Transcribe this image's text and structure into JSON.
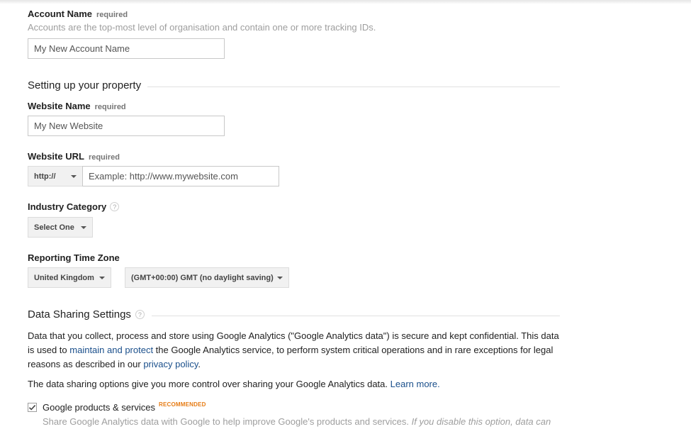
{
  "account": {
    "label": "Account Name",
    "required": "required",
    "help": "Accounts are the top-most level of organisation and contain one or more tracking IDs.",
    "placeholder": "My New Account Name"
  },
  "property": {
    "section_title": "Setting up your property",
    "website_name_label": "Website Name",
    "website_name_required": "required",
    "website_name_placeholder": "My New Website",
    "website_url_label": "Website URL",
    "website_url_required": "required",
    "protocol": "http://",
    "url_placeholder": "Example: http://www.mywebsite.com",
    "industry_label": "Industry Category",
    "industry_help": "?",
    "industry_value": "Select One",
    "timezone_label": "Reporting Time Zone",
    "country_value": "United Kingdom",
    "timezone_value": "(GMT+00:00) GMT (no daylight saving)"
  },
  "data_sharing": {
    "title": "Data Sharing Settings",
    "help": "?",
    "p1_a": "Data that you collect, process and store using Google Analytics (\"Google Analytics data\") is secure and kept confidential. This data is used to ",
    "p1_link1": "maintain and protect",
    "p1_b": " the Google Analytics service, to perform system critical operations and in rare exceptions for legal reasons as described in our ",
    "p1_link2": "privacy policy",
    "p1_c": ".",
    "p2_a": "The data sharing options give you more control over sharing your Google Analytics data. ",
    "p2_link": "Learn more.",
    "option1_label": "Google products & services",
    "option1_badge": "RECOMMENDED",
    "option1_checked": true,
    "option1_desc": "Share Google Analytics data with Google to help improve Google's products and services. ",
    "option1_desc_italic": "If you disable this option, data can"
  },
  "colors": {
    "link": "#1a4f8b",
    "recommended": "#e67c15",
    "muted": "#9e9e9e"
  }
}
